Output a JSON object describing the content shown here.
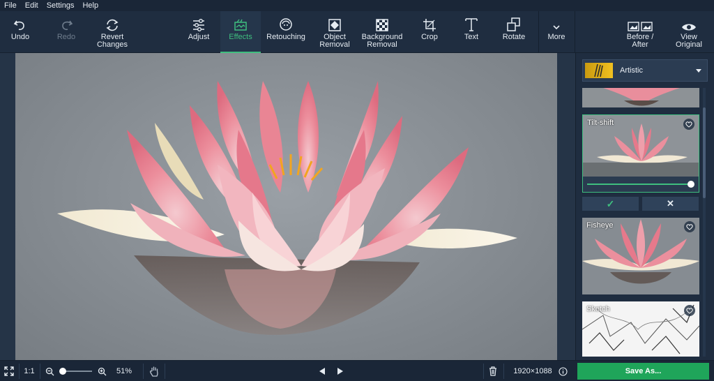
{
  "menu": [
    "File",
    "Edit",
    "Settings",
    "Help"
  ],
  "toolbar": {
    "undo": "Undo",
    "redo": "Redo",
    "revert": "Revert\nChanges",
    "adjust": "Adjust",
    "effects": "Effects",
    "retouching": "Retouching",
    "object_removal": "Object\nRemoval",
    "background_removal": "Background\nRemoval",
    "crop": "Crop",
    "text": "Text",
    "rotate": "Rotate",
    "more": "More",
    "before_after": "Before /\nAfter",
    "view_original": "View\nOriginal"
  },
  "panel": {
    "category": "Artistic",
    "effects": [
      {
        "name": ""
      },
      {
        "name": "Tilt-shift"
      },
      {
        "name": "Fisheye"
      },
      {
        "name": "Sketch"
      }
    ],
    "apply_label": "✓",
    "cancel_label": "✕",
    "intensity": 1.0
  },
  "bottom": {
    "fit_label": "⛶",
    "one_to_one": "1:1",
    "zoom": "51%",
    "dimensions": "1920×1088",
    "save": "Save As..."
  },
  "colors": {
    "accent": "#3fbf7f",
    "save_button": "#1fa55a"
  }
}
